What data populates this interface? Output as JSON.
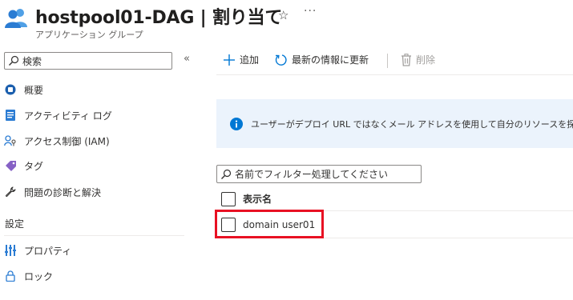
{
  "header": {
    "title": "hostpool01-DAG | 割り当て",
    "subtitle": "アプリケーション グループ",
    "app_icon": "users-group-icon",
    "favorite_icon": "star-icon",
    "more_label": "···"
  },
  "sidebar": {
    "search_placeholder": "検索",
    "collapse_label": "«",
    "items": [
      {
        "label": "概要",
        "icon": "overview-icon"
      },
      {
        "label": "アクティビティ ログ",
        "icon": "activity-log-icon"
      },
      {
        "label": "アクセス制御 (IAM)",
        "icon": "access-control-icon"
      },
      {
        "label": "タグ",
        "icon": "tag-icon"
      },
      {
        "label": "問題の診断と解決",
        "icon": "wrench-icon"
      }
    ],
    "section_label": "設定",
    "settings_items": [
      {
        "label": "プロパティ",
        "icon": "properties-icon"
      },
      {
        "label": "ロック",
        "icon": "lock-icon"
      }
    ]
  },
  "toolbar": {
    "add_label": "追加",
    "refresh_label": "最新の情報に更新",
    "delete_label": "削除"
  },
  "info_banner": {
    "text": "ユーザーがデプロイ URL ではなくメール アドレスを使用して自分のリソースを探索できるよう"
  },
  "filter": {
    "placeholder": "名前でフィルター処理してください"
  },
  "table": {
    "column_header": "表示名",
    "rows": [
      {
        "display_name": "domain user01"
      }
    ]
  },
  "colors": {
    "accent": "#0078d4",
    "highlight": "#e81123",
    "banner_bg": "#ebf3fc"
  }
}
